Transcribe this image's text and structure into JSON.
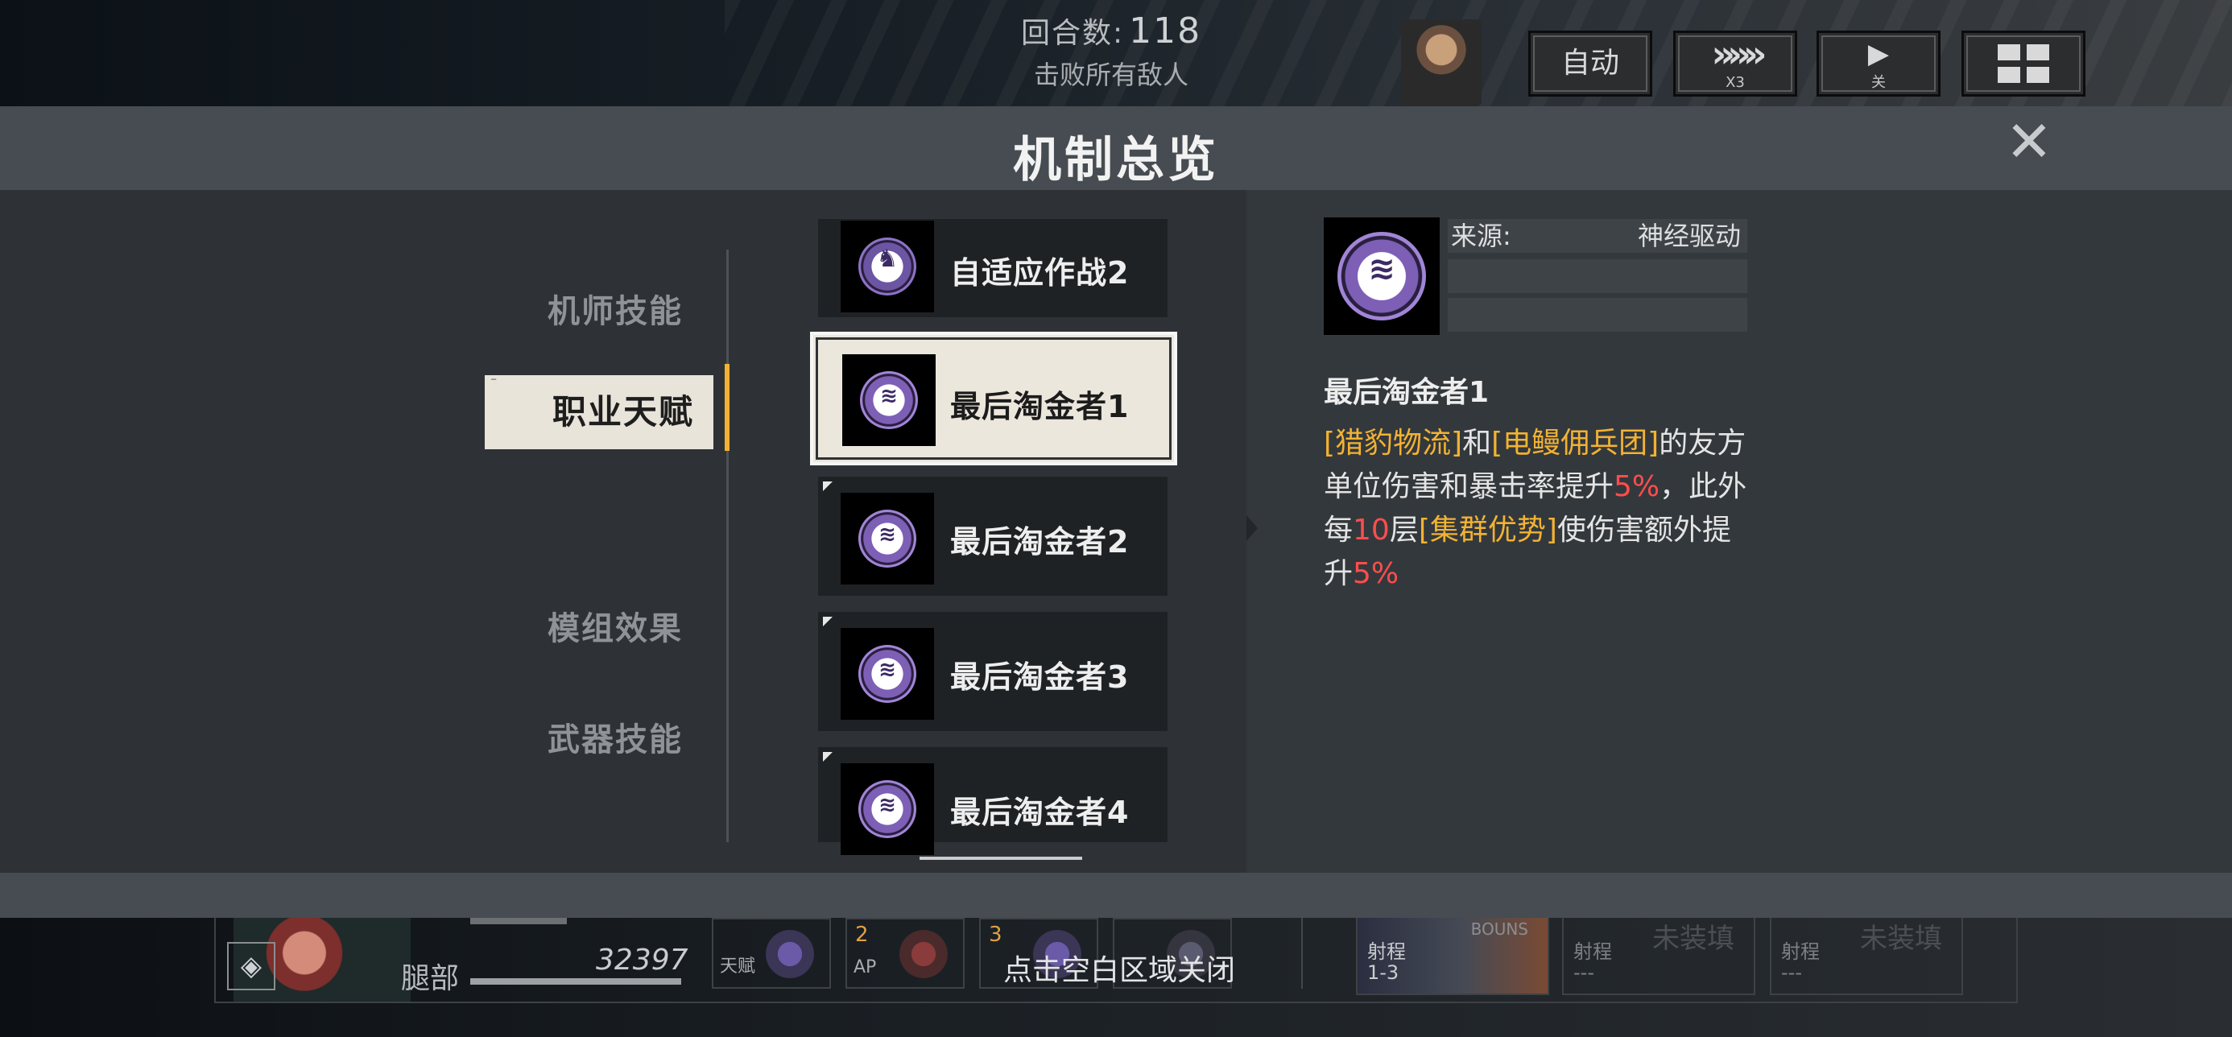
{
  "hud": {
    "turn_label": "回合数:",
    "turn_value": "118",
    "objective": "击败所有敌人",
    "auto_label": "自动",
    "speed_arrows": "»»»",
    "speed_label": "X3",
    "replay_label": "关"
  },
  "modal": {
    "title": "机制总览",
    "close_icon": "close-icon",
    "categories": [
      {
        "label": "机师技能"
      },
      {
        "label": "职业天赋"
      },
      {
        "label": "模组效果"
      },
      {
        "label": "武器技能"
      }
    ],
    "active_category_index": 1,
    "skills": [
      {
        "name": "自适应作战2",
        "icon": "adaptive-emblem-icon"
      },
      {
        "name": "最后淘金者1",
        "icon": "gold-digger-emblem-icon",
        "selected": true
      },
      {
        "name": "最后淘金者2",
        "icon": "gold-digger-emblem-icon"
      },
      {
        "name": "最后淘金者3",
        "icon": "gold-digger-emblem-icon"
      },
      {
        "name": "最后淘金者4",
        "icon": "gold-digger-emblem-icon"
      }
    ],
    "detail": {
      "source_label": "来源:",
      "source_value": "神经驱动",
      "name": "最后淘金者1",
      "desc_parts": [
        "[猎豹物流]",
        "和",
        "[电鳗佣兵团]",
        "的友方单位伤害和暴击率提升",
        "5%",
        "，此外每",
        "10",
        "层",
        "[集群优势]",
        "使伤害额外提升",
        "5%"
      ]
    }
  },
  "bottom_hud": {
    "part_label": "腿部",
    "part_hp": "32397",
    "skill_labels": [
      "天赋",
      "AP",
      "",
      ""
    ],
    "skill_numbers": [
      "",
      "2",
      "3",
      ""
    ],
    "weapons": [
      {
        "title": "射程",
        "value": "1-3",
        "ghost": "BOUNS"
      },
      {
        "title": "射程",
        "value": "---",
        "ghost": "未装填"
      },
      {
        "title": "射程",
        "value": "---",
        "ghost": "未装填"
      }
    ],
    "close_hint": "点击空白区域关闭"
  },
  "colors": {
    "accent_yellow": "#f2b233",
    "accent_red": "#ff4d4d",
    "modal_header": "#464c51",
    "modal_body": "#2e3236"
  }
}
